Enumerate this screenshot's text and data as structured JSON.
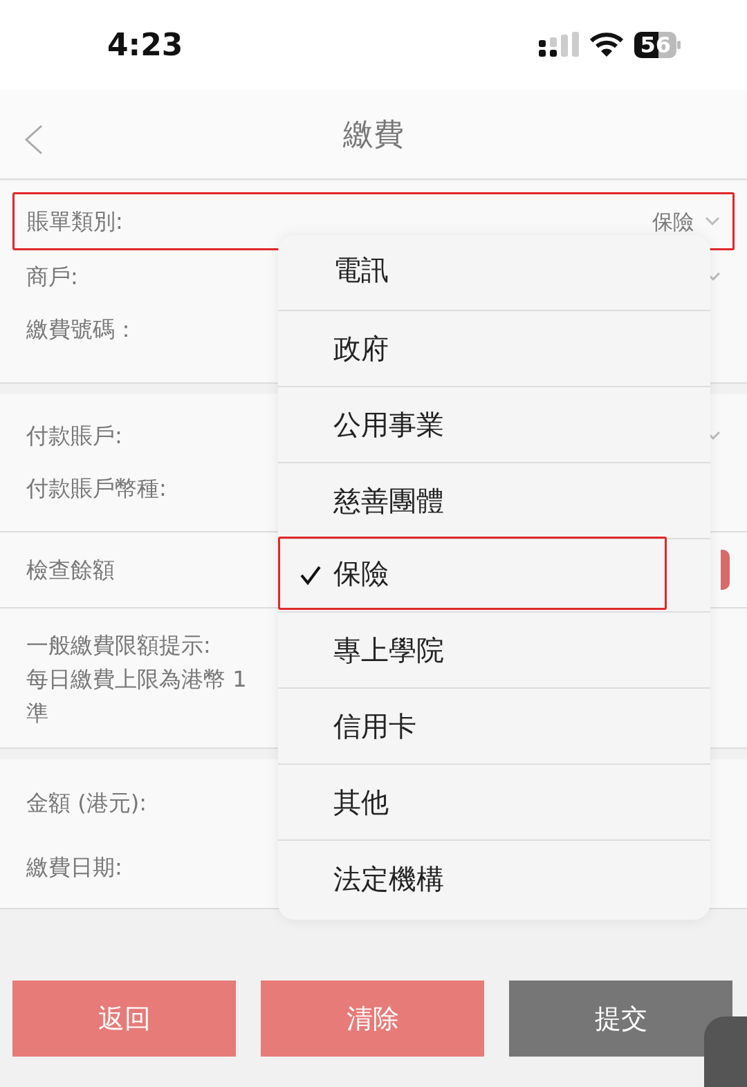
{
  "status_bar": {
    "time": "4:23",
    "battery": "56"
  },
  "header": {
    "title": "繳費"
  },
  "sections": [
    {
      "rows": [
        {
          "label": "賬單類別:",
          "value": "保險",
          "kind": "select",
          "annotated": true
        },
        {
          "label": "商戶:",
          "kind": "select",
          "annotated": false
        },
        {
          "label": "繳費號碼：",
          "kind": "text",
          "annotated": false
        }
      ]
    },
    {
      "rows": [
        {
          "label": "付款賬戶:",
          "kind": "select",
          "annotated": false
        },
        {
          "label": "付款賬戶幣種:",
          "kind": "text",
          "annotated": false
        }
      ]
    },
    {
      "rows": [
        {
          "label": "檢查餘額",
          "kind": "button",
          "annotated": false
        }
      ]
    },
    {
      "rows": [
        {
          "label": "一般繳費限額提示:",
          "kind": "note",
          "annotated": false
        },
        {
          "label": "每日繳費上限為港幣 1",
          "kind": "note",
          "annotated": false
        },
        {
          "label": "準",
          "kind": "note",
          "annotated": false
        }
      ]
    },
    {
      "rows": [
        {
          "label": "金額 (港元):",
          "kind": "text",
          "annotated": false
        },
        {
          "label": "繳費日期:",
          "kind": "text",
          "annotated": false
        }
      ]
    }
  ],
  "dropdown": {
    "options": [
      {
        "label": "電訊",
        "selected": false,
        "annotated": false
      },
      {
        "label": "政府",
        "selected": false,
        "annotated": false
      },
      {
        "label": "公用事業",
        "selected": false,
        "annotated": false
      },
      {
        "label": "慈善團體",
        "selected": false,
        "annotated": false
      },
      {
        "label": "保險",
        "selected": true,
        "annotated": true
      },
      {
        "label": "專上學院",
        "selected": false,
        "annotated": false
      },
      {
        "label": "信用卡",
        "selected": false,
        "annotated": false
      },
      {
        "label": "其他",
        "selected": false,
        "annotated": false
      },
      {
        "label": "法定機構",
        "selected": false,
        "annotated": false
      }
    ]
  },
  "buttons": [
    {
      "label": "返回",
      "kind": "primary"
    },
    {
      "label": "清除",
      "kind": "primary"
    },
    {
      "label": "提交",
      "kind": "secondary"
    }
  ]
}
